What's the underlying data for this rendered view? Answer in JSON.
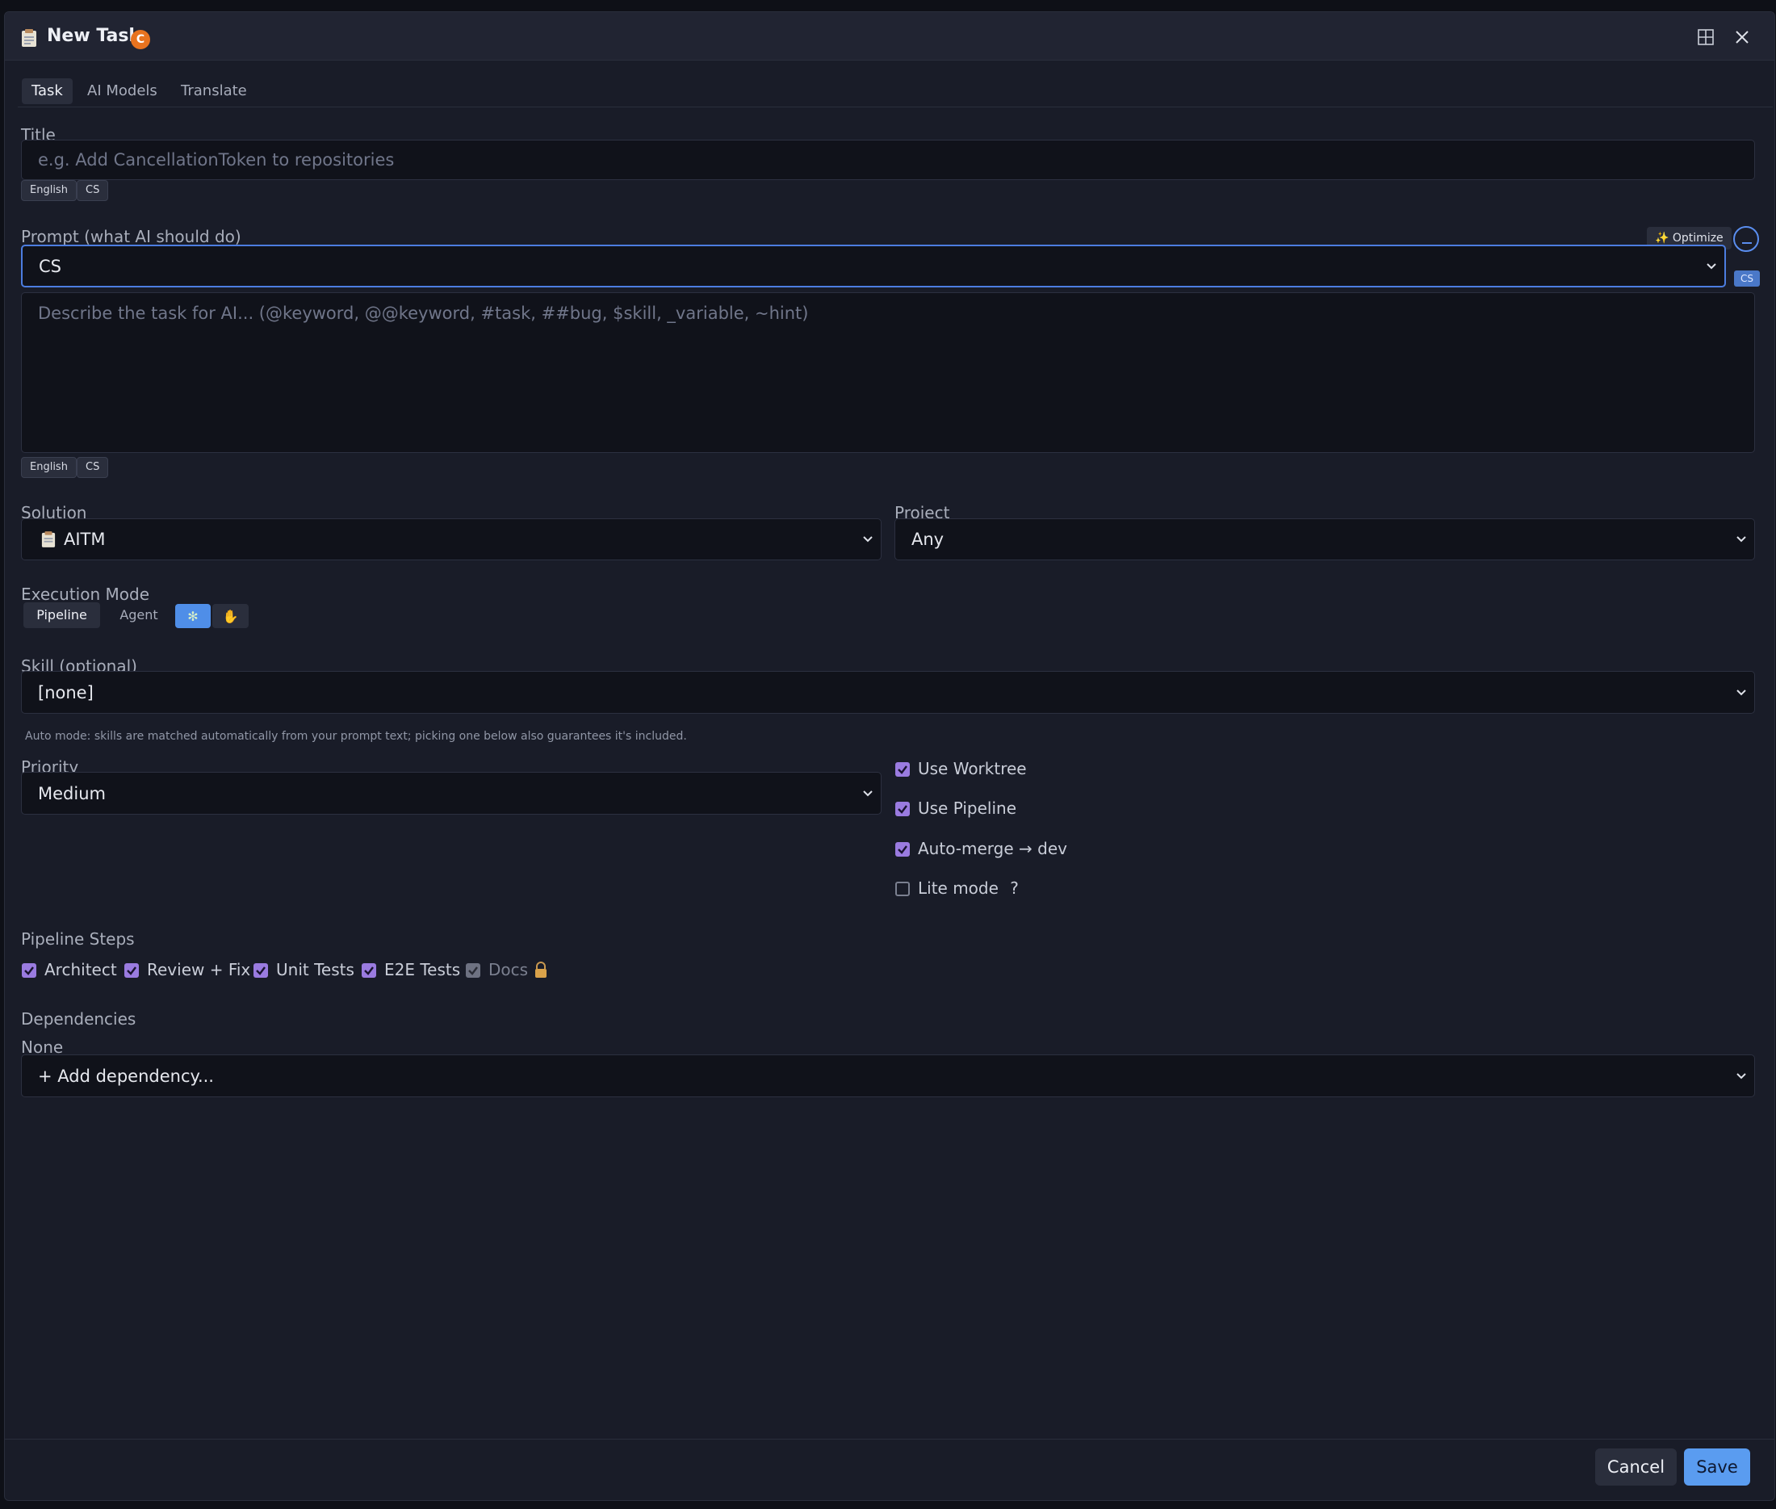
{
  "dialog": {
    "title": "New Task",
    "badge": "C"
  },
  "tabs": [
    {
      "label": "Task",
      "active": true
    },
    {
      "label": "AI Models",
      "active": false
    },
    {
      "label": "Translate",
      "active": false
    }
  ],
  "title_field": {
    "label": "Title",
    "placeholder": "e.g. Add CancellationToken to repositories",
    "lang_pills": [
      "English",
      "CS"
    ]
  },
  "prompt": {
    "label": "Prompt (what AI should do)",
    "optimize_label": "Optimize",
    "language_select": "CS",
    "language_tag": "CS",
    "placeholder": "Describe the task for AI... (@keyword, @@keyword, #task, ##bug, $skill, _variable, ~hint)",
    "lang_pills": [
      "English",
      "CS"
    ]
  },
  "solution": {
    "label": "Solution",
    "value": "AITM"
  },
  "project": {
    "label": "Project",
    "value": "Any"
  },
  "execution_mode": {
    "label": "Execution Mode",
    "options": [
      "Pipeline",
      "Agent"
    ],
    "selected": "Pipeline"
  },
  "skill": {
    "label": "Skill (optional)",
    "value": "[none]",
    "hint": "Auto mode: skills are matched automatically from your prompt text; picking one below also guarantees it's included."
  },
  "priority": {
    "label": "Priority",
    "value": "Medium"
  },
  "options": [
    {
      "label": "Use Worktree",
      "checked": true
    },
    {
      "label": "Use Pipeline",
      "checked": true
    },
    {
      "label": "Auto-merge → dev",
      "checked": true
    },
    {
      "label": "Lite mode",
      "checked": false,
      "help": "?"
    }
  ],
  "pipeline_steps": {
    "label": "Pipeline Steps",
    "steps": [
      {
        "label": "Architect",
        "checked": true
      },
      {
        "label": "Review + Fix",
        "checked": true
      },
      {
        "label": "Unit Tests",
        "checked": true
      },
      {
        "label": "E2E Tests",
        "checked": true
      },
      {
        "label": "Docs",
        "checked": true,
        "disabled": true,
        "locked": true
      }
    ]
  },
  "dependencies": {
    "label": "Dependencies",
    "value": "None",
    "add_label": "+ Add dependency..."
  },
  "footer": {
    "cancel_label": "Cancel",
    "save_label": "Save"
  },
  "colors": {
    "accent": "#5a9cf0",
    "checkbox": "#9a7be0",
    "badge": "#e8731f"
  }
}
